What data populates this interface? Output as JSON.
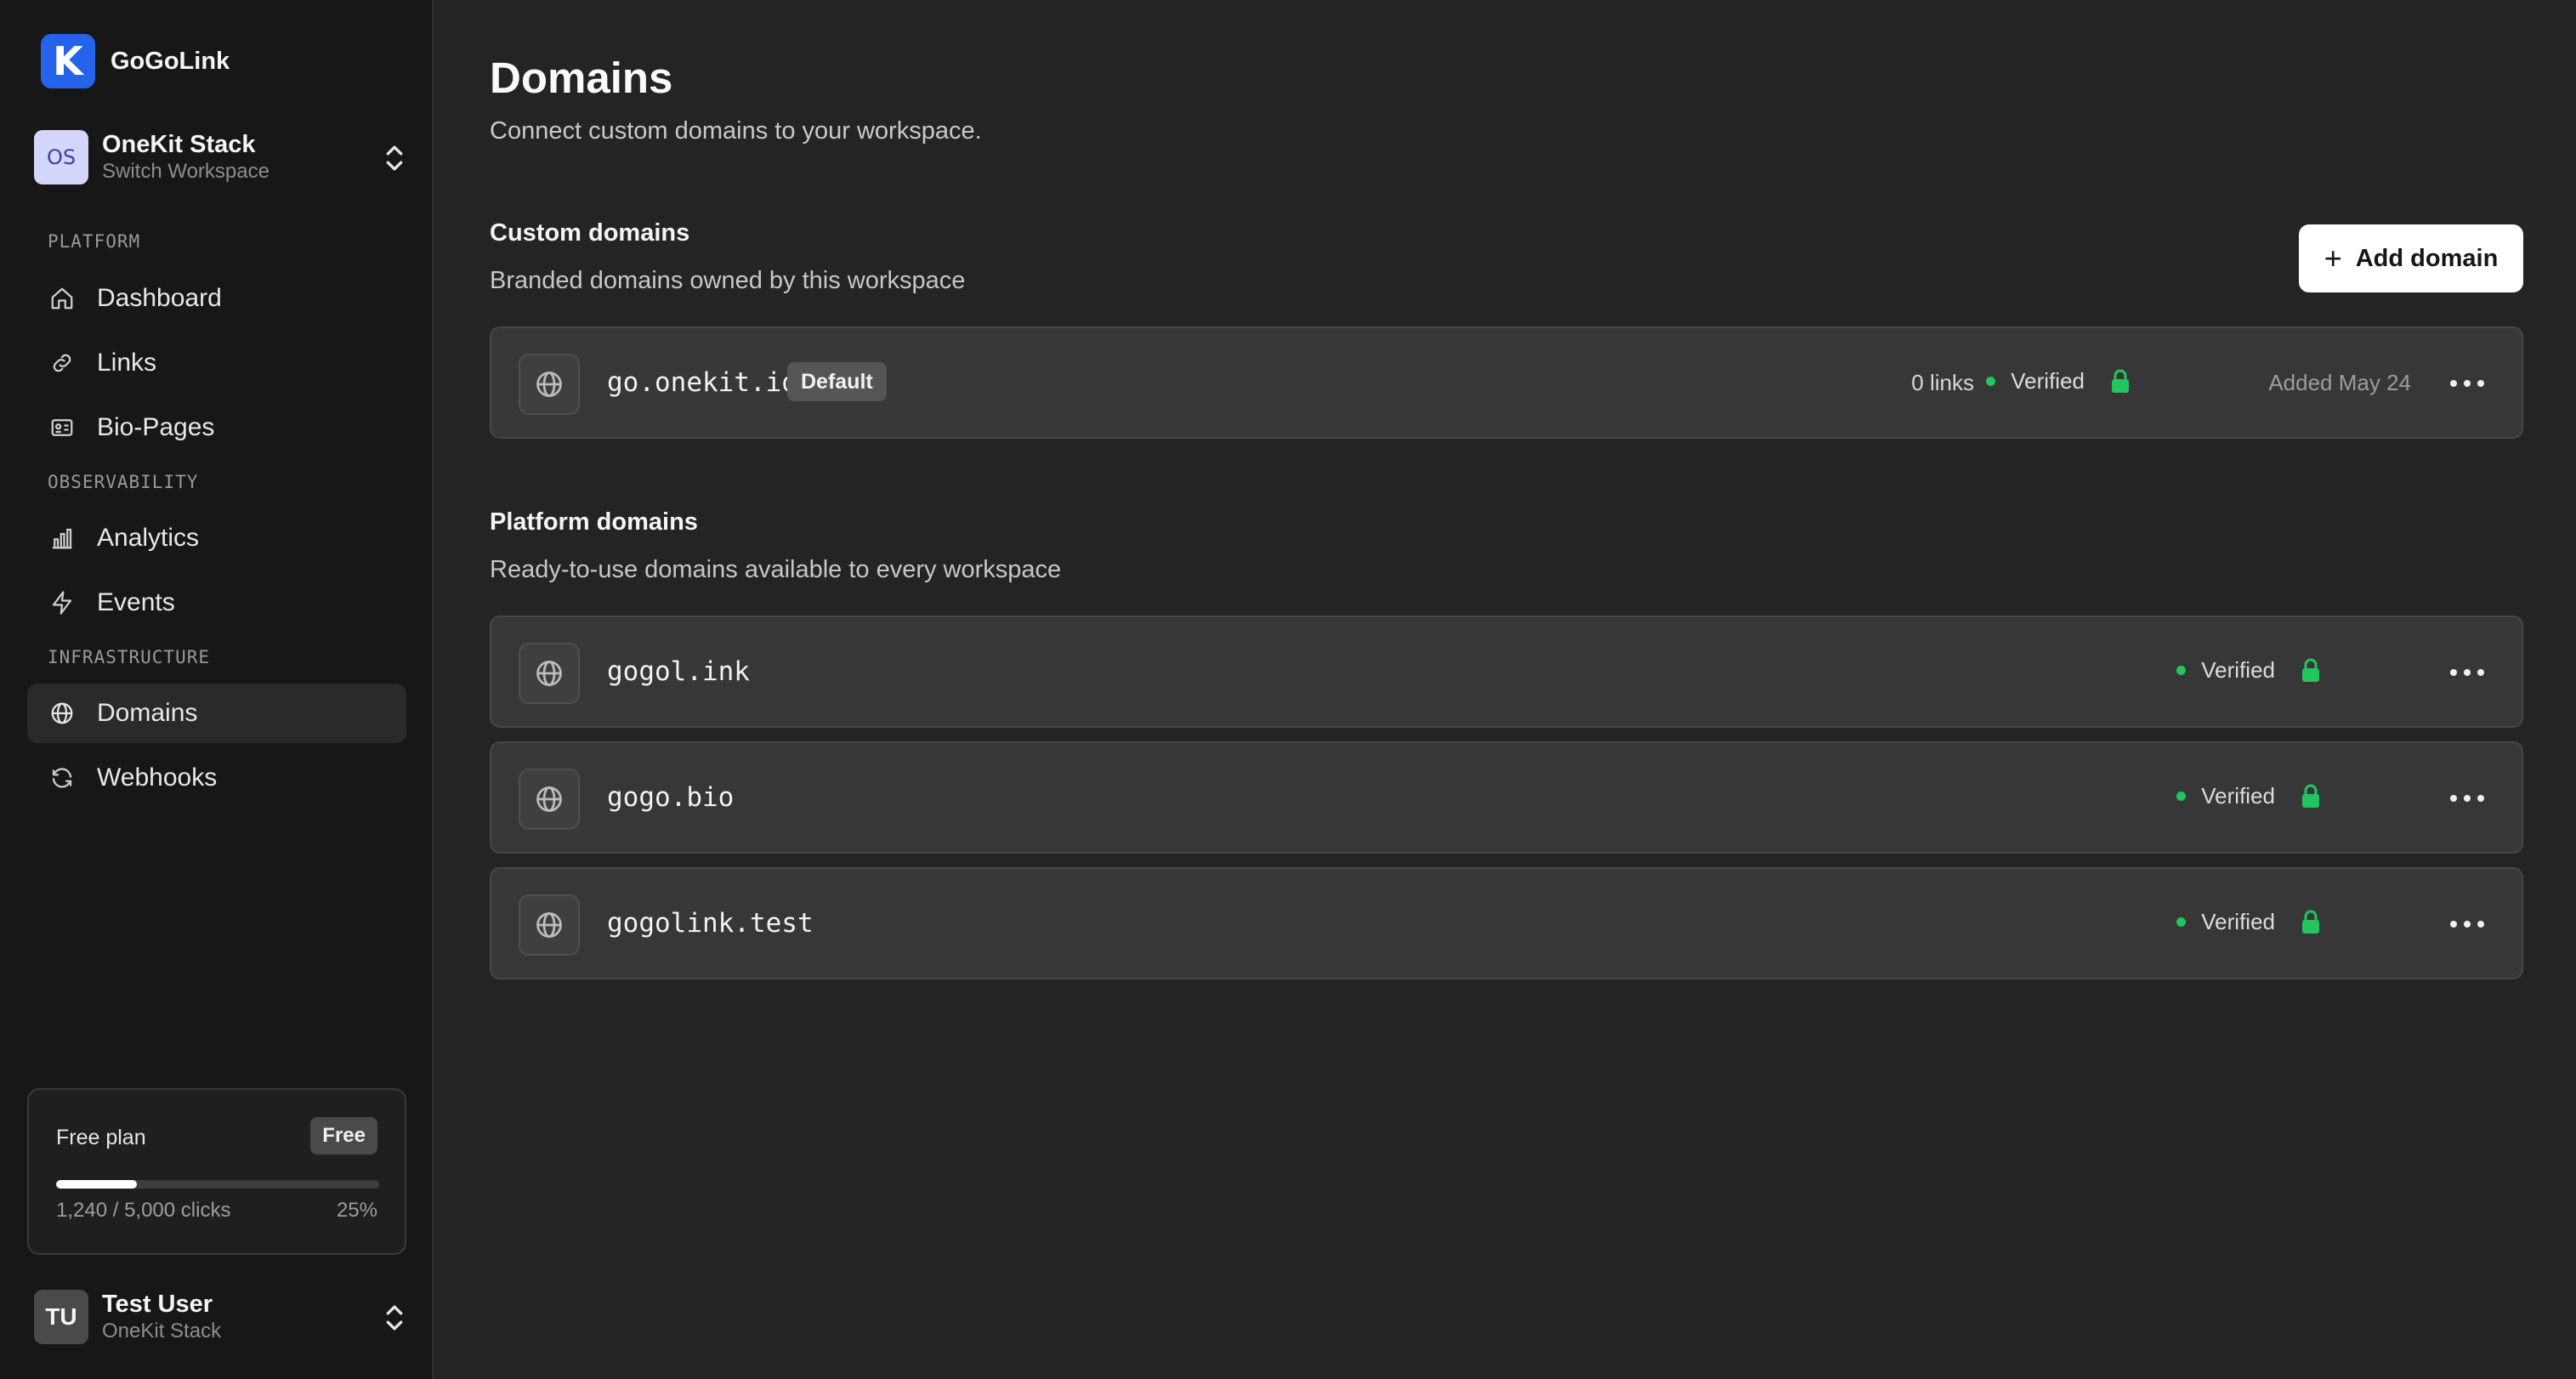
{
  "app": {
    "name": "GoGoLink",
    "logo_letter": "K",
    "accent_color": "#2563eb"
  },
  "workspace": {
    "initials": "OS",
    "name": "OneKit Stack",
    "action": "Switch Workspace"
  },
  "sidebar": {
    "sections": [
      {
        "label": "PLATFORM"
      },
      {
        "label": "OBSERVABILITY"
      },
      {
        "label": "INFRASTRUCTURE"
      }
    ],
    "items": [
      {
        "label": "Dashboard",
        "icon": "home-icon"
      },
      {
        "label": "Links",
        "icon": "link-icon"
      },
      {
        "label": "Bio-Pages",
        "icon": "id-card-icon"
      },
      {
        "label": "Analytics",
        "icon": "bar-chart-icon"
      },
      {
        "label": "Events",
        "icon": "lightning-icon"
      },
      {
        "label": "Domains",
        "icon": "globe-icon",
        "active": true
      },
      {
        "label": "Webhooks",
        "icon": "refresh-icon"
      }
    ]
  },
  "plan": {
    "title": "Free plan",
    "badge": "Free",
    "usage": "1,240 / 5,000 clicks",
    "percent_label": "25%",
    "progress": 0.25
  },
  "user": {
    "initials": "TU",
    "name": "Test User",
    "workspace": "OneKit Stack"
  },
  "page": {
    "title": "Domains",
    "subtitle": "Connect custom domains to your workspace."
  },
  "custom_domains": {
    "title": "Custom domains",
    "subtitle": "Branded domains owned by this workspace",
    "add_button": "Add domain",
    "rows": [
      {
        "domain": "go.onekit.io",
        "badge": "Default",
        "links": "0 links",
        "status": "Verified",
        "added": "Added May 24"
      }
    ]
  },
  "platform_domains": {
    "title": "Platform domains",
    "subtitle": "Ready-to-use domains available to every workspace",
    "rows": [
      {
        "domain": "gogol.ink",
        "status": "Verified"
      },
      {
        "domain": "gogo.bio",
        "status": "Verified"
      },
      {
        "domain": "gogolink.test",
        "status": "Verified"
      }
    ]
  },
  "colors": {
    "verified": "#22c55e"
  }
}
